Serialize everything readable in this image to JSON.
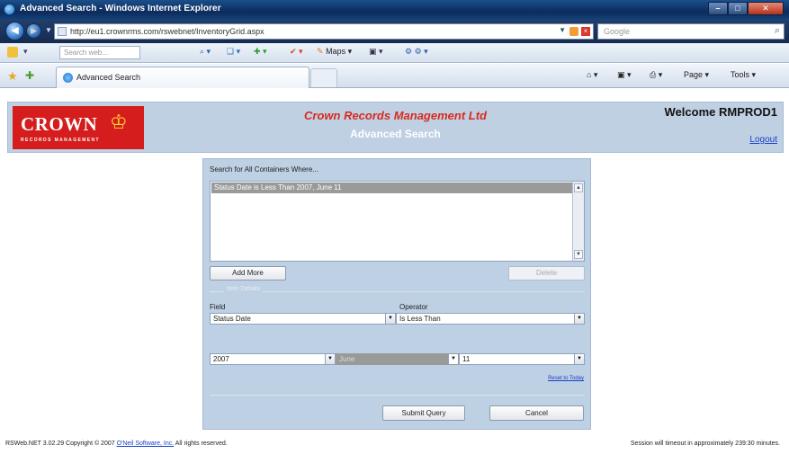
{
  "window": {
    "title": "Advanced Search - Windows Internet Explorer",
    "minimize": "–",
    "maximize": "□",
    "close": "✕"
  },
  "browser": {
    "url": "http://eu1.crownrms.com/rswebnet/InventoryGrid.aspx",
    "search_placeholder": "Google",
    "toolbar_search_placeholder": "Search web...",
    "maps_label": "Maps",
    "tab_title": "Advanced Search",
    "commands": {
      "page": "Page ▾",
      "tools": "Tools ▾"
    }
  },
  "header": {
    "logo_word": "CROWN",
    "logo_sub": "RECORDS MANAGEMENT",
    "company": "Crown Records Management Ltd",
    "page_title": "Advanced Search",
    "welcome": "Welcome RMPROD1",
    "logout": "Logout"
  },
  "search": {
    "heading": "Search for All Containers Where...",
    "criteria": [
      "Status Date is Less Than 2007, June 11"
    ],
    "add_more": "Add More",
    "delete": "Delete",
    "fieldset_legend": "Item Details",
    "field_label": "Field",
    "field_value": "Status Date",
    "operator_label": "Operator",
    "operator_value": "Is Less Than",
    "year": "2007",
    "month": "June",
    "day": "11",
    "reset_today": "Reset to Today",
    "submit": "Submit Query",
    "cancel": "Cancel"
  },
  "footer": {
    "left_prefix": "RSWeb.NET 3.02.29 Copyright © 2007 ",
    "left_link": "O'Neil Software, Inc.",
    "left_suffix": " All rights reserved.",
    "right": "Session will timeout in approximately 239:30 minutes."
  }
}
